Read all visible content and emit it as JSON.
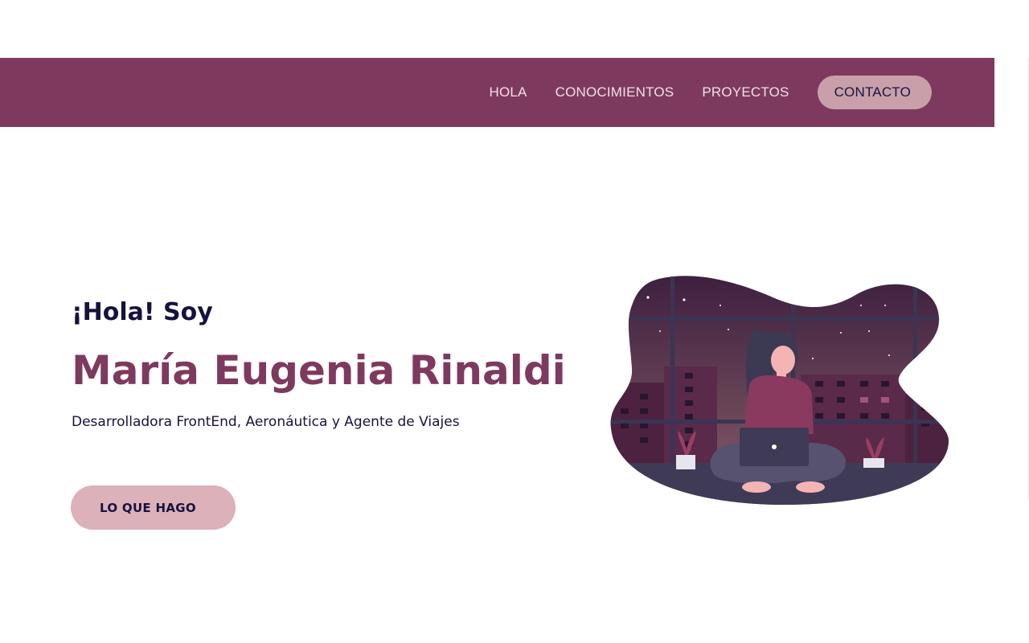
{
  "nav": {
    "items": [
      {
        "label": "HOLA"
      },
      {
        "label": "CONOCIMIENTOS"
      },
      {
        "label": "PROYECTOS"
      }
    ],
    "contact_label": "CONTACTO"
  },
  "hero": {
    "greeting": "¡Hola! Soy",
    "name": "María Eugenia Rinaldi",
    "subtitle": "Desarrolladora FrontEnd, Aeronáutica y Agente de Viajes",
    "cta_label": "LO QUE HAGO"
  },
  "colors": {
    "navbar": "#7e3a5e",
    "accent": "#7e3a5e",
    "contact_button": "#c9a0aa",
    "cta_button": "#dcb1b9",
    "text_dark": "#15123f"
  },
  "illustration": {
    "icon": "woman-with-laptop-night-city-illustration"
  }
}
